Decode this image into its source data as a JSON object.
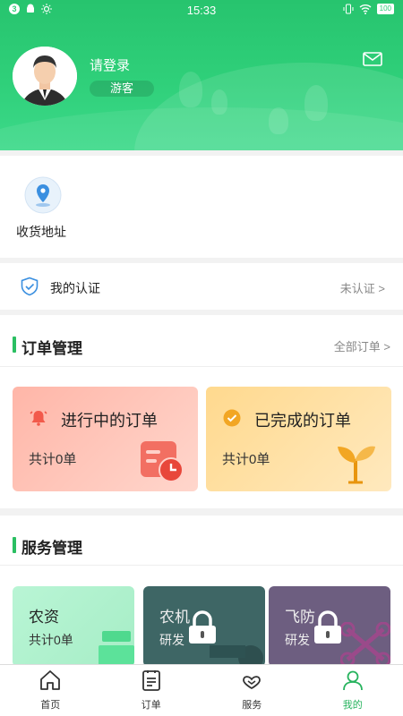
{
  "status_bar": {
    "notif_count": "3",
    "time": "15:33",
    "battery": "100"
  },
  "profile": {
    "login_text": "请登录",
    "role_badge": "游客"
  },
  "address": {
    "label": "收货地址"
  },
  "certification": {
    "label": "我的认证",
    "status": "未认证 >"
  },
  "orders": {
    "title": "订单管理",
    "all_link": "全部订单 >",
    "in_progress": {
      "title": "进行中的订单",
      "count": "共计0单"
    },
    "completed": {
      "title": "已完成的订单",
      "count": "共计0单"
    }
  },
  "services": {
    "title": "服务管理",
    "items": [
      {
        "title": "农资",
        "subtitle": "共计0单"
      },
      {
        "title": "农机",
        "subtitle": "研发"
      },
      {
        "title": "飞防",
        "subtitle": "研发"
      }
    ]
  },
  "tabbar": {
    "items": [
      {
        "label": "首页"
      },
      {
        "label": "订单"
      },
      {
        "label": "服务"
      },
      {
        "label": "我的"
      }
    ],
    "active_color": "#27b35e"
  }
}
